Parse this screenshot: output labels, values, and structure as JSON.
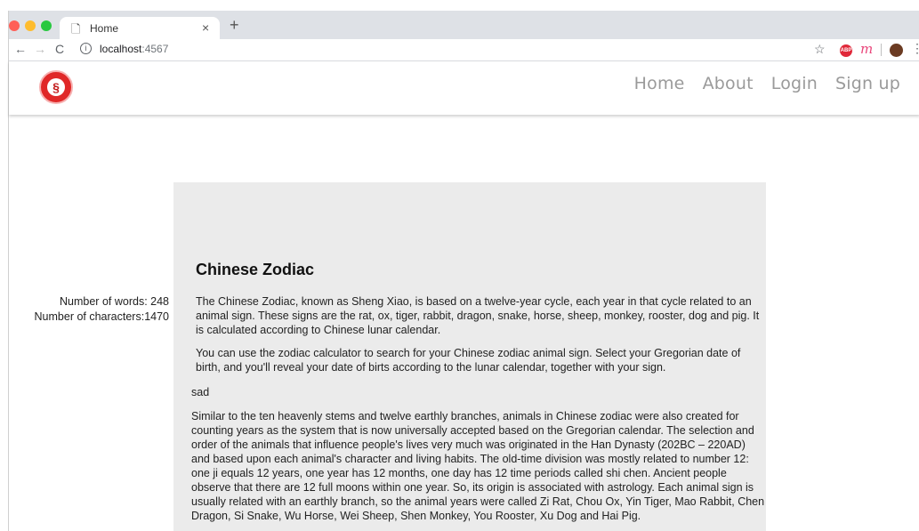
{
  "browser": {
    "tab_title": "Home",
    "url_host": "localhost",
    "url_port": ":4567",
    "extensions": [
      "abp-icon",
      "mention-icon"
    ],
    "abp_label": "ABP",
    "m_label": "m"
  },
  "site": {
    "nav": [
      "Home",
      "About",
      "Login",
      "Sign up"
    ],
    "logo_symbol": "§"
  },
  "stats": {
    "words": "Number of words: 248",
    "characters": "Number of characters:1470"
  },
  "article": {
    "title": "Chinese Zodiac",
    "p1": "The Chinese Zodiac, known as Sheng Xiao, is based on a twelve-year cycle, each year in that cycle related to an animal sign. These signs are the rat, ox, tiger, rabbit, dragon, snake, horse, sheep, monkey, rooster, dog and pig. It is calculated according to Chinese lunar calendar.",
    "p2": "You can use the zodiac calculator to search for your Chinese zodiac animal sign. Select your Gregorian date of birth, and you'll reveal your date of birts according to the lunar calendar, together with your sign.",
    "p3": "sad",
    "p4": "Similar to the ten heavenly stems and twelve earthly branches, animals in Chinese zodiac were also created for counting years as the system that is now universally accepted based on the Gregorian calendar. The selection and order of the animals that influence people's lives very much was originated in the Han Dynasty (202BC – 220AD) and based upon each animal's character and living habits. The old-time division was mostly related to number 12: one ji equals 12 years, one year has 12 months, one day has 12 time periods called shi chen. Ancient people observe that there are 12 full moons within one year. So, its origin is associated with astrology. Each animal sign is usually related with an earthly branch, so the animal years were called Zi Rat, Chou Ox, Yin Tiger, Mao Rabbit, Chen Dragon, Si Snake, Wu Horse, Wei Sheep, Shen Monkey, You Rooster, Xu Dog and Hai Pig."
  }
}
